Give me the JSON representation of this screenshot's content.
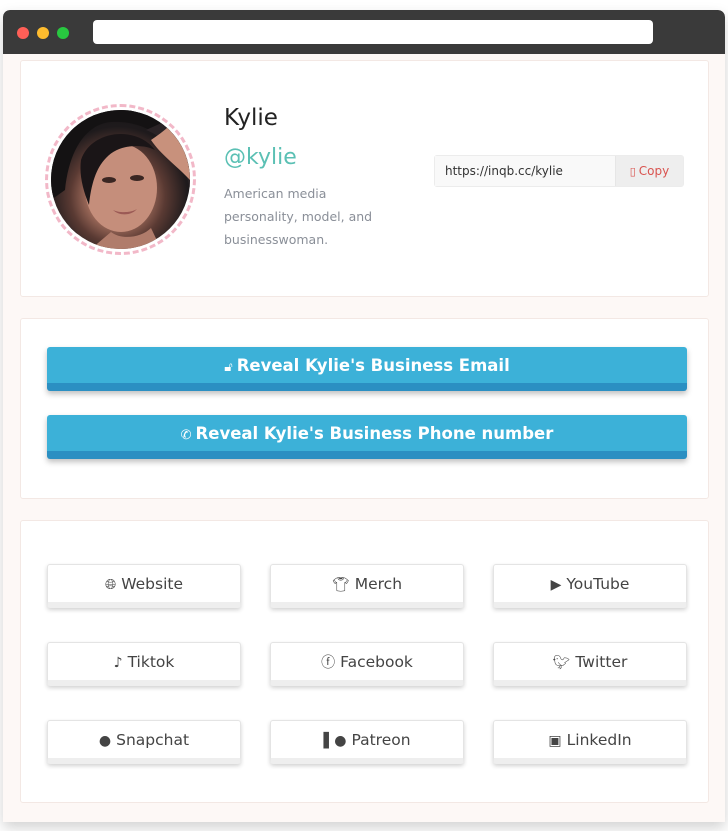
{
  "browser": {
    "url": ""
  },
  "profile": {
    "name": "Kylie",
    "handle": "@kylie",
    "bio": "American media personality, model, and businesswoman.",
    "share_url": "https://inqb.cc/kylie",
    "copy_label": "Copy",
    "copy_icon": "copy-icon"
  },
  "reveal": {
    "email_label": "Reveal Kylie's Business Email",
    "email_icon": "lock-icon",
    "phone_label": "Reveal Kylie's Business Phone number",
    "phone_icon": "phone-icon"
  },
  "links": [
    {
      "label": "Website",
      "icon": "globe-icon"
    },
    {
      "label": "Merch",
      "icon": "tshirt-icon"
    },
    {
      "label": "YouTube",
      "icon": "youtube-icon"
    },
    {
      "label": "Tiktok",
      "icon": "tiktok-icon"
    },
    {
      "label": "Facebook",
      "icon": "facebook-icon"
    },
    {
      "label": "Twitter",
      "icon": "twitter-icon"
    },
    {
      "label": "Snapchat",
      "icon": "snapchat-icon"
    },
    {
      "label": "Patreon",
      "icon": "patreon-icon"
    },
    {
      "label": "LinkedIn",
      "icon": "linkedin-icon"
    }
  ],
  "colors": {
    "handle": "#5bc0b4",
    "reveal_button": "#3cb1d8",
    "copy_text": "#d9534f",
    "avatar_ring": "#f2b8c8"
  }
}
